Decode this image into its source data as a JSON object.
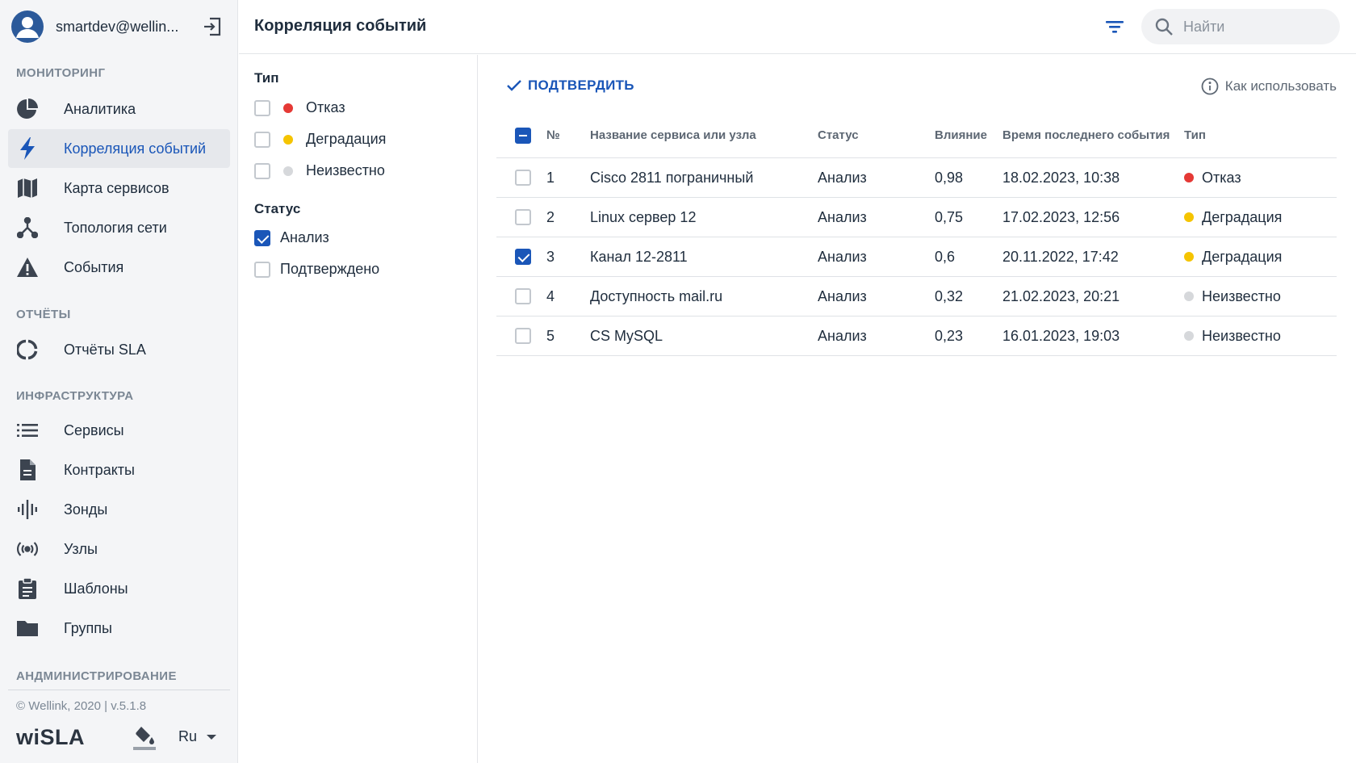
{
  "user": {
    "email": "smartdev@wellin..."
  },
  "sidebar": {
    "sections": {
      "monitoring": "МОНИТОРИНГ",
      "reports": "ОТЧЁТЫ",
      "infrastructure": "ИНФРАСТРУКТУРА",
      "admin": "АНДМИНИСТРИРОВАНИЕ"
    },
    "items": [
      {
        "label": "Аналитика",
        "icon": "pie-chart-icon"
      },
      {
        "label": "Корреляция событий",
        "icon": "lightning-icon",
        "active": true
      },
      {
        "label": "Карта сервисов",
        "icon": "map-icon"
      },
      {
        "label": "Топология сети",
        "icon": "topology-icon"
      },
      {
        "label": "События",
        "icon": "warning-icon"
      },
      {
        "label": "Отчёты SLA",
        "icon": "sla-ring-icon"
      },
      {
        "label": "Сервисы",
        "icon": "list-icon"
      },
      {
        "label": "Контракты",
        "icon": "document-icon"
      },
      {
        "label": "Зонды",
        "icon": "probe-icon"
      },
      {
        "label": "Узлы",
        "icon": "antenna-icon"
      },
      {
        "label": "Шаблоны",
        "icon": "clipboard-icon"
      },
      {
        "label": "Группы",
        "icon": "folder-icon"
      }
    ],
    "footer": {
      "copyright": "© Wellink, 2020 | v.5.1.8",
      "logo": "wiSLA",
      "language": "Ru"
    }
  },
  "header": {
    "title": "Корреляция событий",
    "search_placeholder": "Найти"
  },
  "filters": {
    "type_heading": "Тип",
    "type_options": [
      {
        "label": "Отказ",
        "color": "#e53935",
        "checked": false
      },
      {
        "label": "Деградация",
        "color": "#f5c400",
        "checked": false
      },
      {
        "label": "Неизвестно",
        "color": "#d6d8db",
        "checked": false
      }
    ],
    "status_heading": "Статус",
    "status_options": [
      {
        "label": "Анализ",
        "checked": true
      },
      {
        "label": "Подтверждено",
        "checked": false
      }
    ]
  },
  "main": {
    "confirm_label": "ПОДТВЕРДИТЬ",
    "howto_label": "Как использовать",
    "columns": {
      "num": "№",
      "name": "Название сервиса или узла",
      "status": "Статус",
      "impact": "Влияние",
      "time": "Время последнего события",
      "type": "Тип"
    },
    "rows": [
      {
        "num": "1",
        "name": "Cisco 2811 пограничный",
        "status": "Анализ",
        "impact": "0,98",
        "time": "18.02.2023, 10:38",
        "type": "Отказ",
        "type_color": "#e53935",
        "checked": false
      },
      {
        "num": "2",
        "name": "Linux сервер 12",
        "status": "Анализ",
        "impact": "0,75",
        "time": "17.02.2023, 12:56",
        "type": "Деградация",
        "type_color": "#f5c400",
        "checked": false
      },
      {
        "num": "3",
        "name": "Канал 12-2811",
        "status": "Анализ",
        "impact": "0,6",
        "time": "20.11.2022, 17:42",
        "type": "Деградация",
        "type_color": "#f5c400",
        "checked": true
      },
      {
        "num": "4",
        "name": "Доступность mail.ru",
        "status": "Анализ",
        "impact": "0,32",
        "time": "21.02.2023, 20:21",
        "type": "Неизвестно",
        "type_color": "#d6d8db",
        "checked": false
      },
      {
        "num": "5",
        "name": "CS MySQL",
        "status": "Анализ",
        "impact": "0,23",
        "time": "16.01.2023, 19:03",
        "type": "Неизвестно",
        "type_color": "#d6d8db",
        "checked": false
      }
    ]
  },
  "colors": {
    "accent": "#1a56b8",
    "failure": "#e53935",
    "degradation": "#f5c400",
    "unknown": "#d6d8db"
  }
}
